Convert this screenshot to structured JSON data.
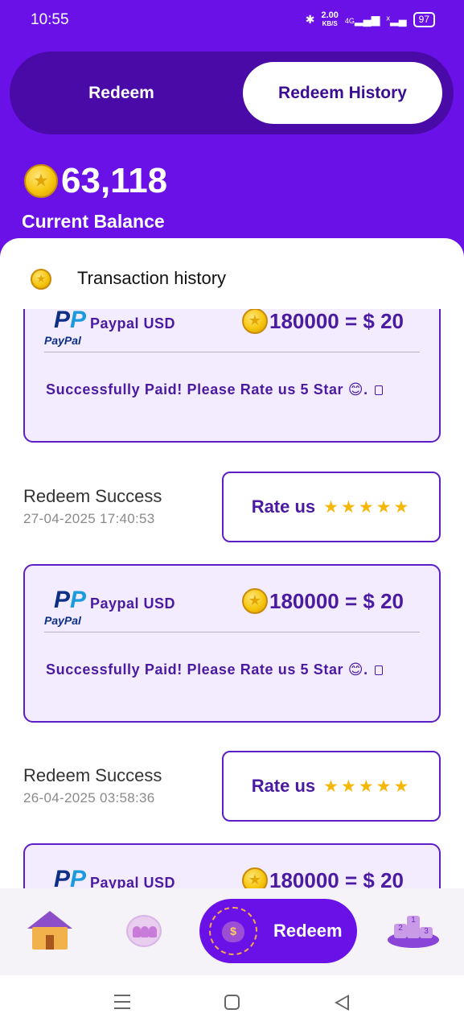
{
  "status_bar": {
    "time": "10:55",
    "speed_value": "2.00",
    "speed_unit": "KB/S",
    "network": "4G",
    "battery": "97"
  },
  "tabs": {
    "redeem": "Redeem",
    "history": "Redeem History"
  },
  "balance": {
    "value": "63,118",
    "label": "Current Balance"
  },
  "section": {
    "title": "Transaction history"
  },
  "payment": {
    "method": "Paypal USD",
    "brand_logo_text": "PayPal",
    "amount": "180000 = $ 20",
    "message": "Successfully Paid! Please Rate us 5 Star 😊."
  },
  "entries": [
    {
      "title": "Redeem Success",
      "date": "27-04-2025 17:40:53",
      "rate_label": "Rate us",
      "stars": "★★★★★"
    },
    {
      "title": "Redeem Success",
      "date": "26-04-2025 03:58:36",
      "rate_label": "Rate us",
      "stars": "★★★★★"
    }
  ],
  "bottom_nav": {
    "redeem_label": "Redeem"
  },
  "icons": [
    "bluetooth-icon",
    "signal-icon",
    "battery-icon",
    "coin-icon",
    "paypal-logo",
    "copy-icon",
    "star-icon",
    "house-icon",
    "users-icon",
    "money-bag-icon",
    "podium-icon",
    "menu-icon",
    "home-icon",
    "back-icon"
  ],
  "colors": {
    "primary": "#6a11e8",
    "primary_dark": "#4a0aa8",
    "card_bg": "#f2ecfe",
    "accent_text": "#4a1aa0",
    "star": "#f6b70b"
  }
}
